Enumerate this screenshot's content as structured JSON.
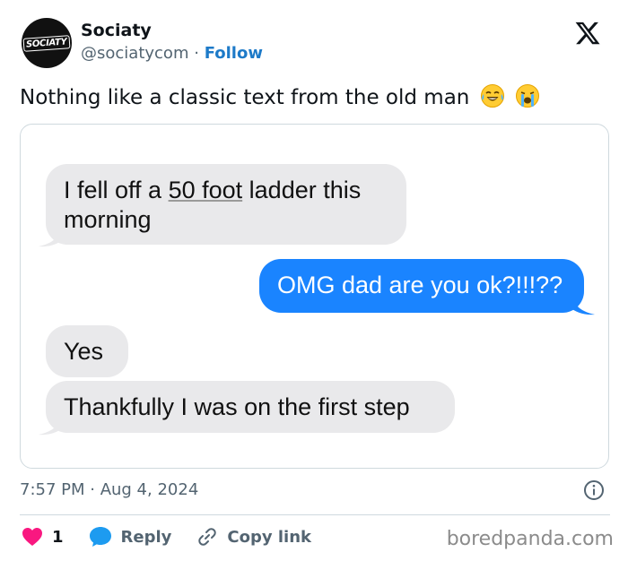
{
  "author": {
    "display_name": "Sociaty",
    "handle": "@sociatycom",
    "separator": "·",
    "follow_label": "Follow",
    "avatar_text": "SOCIATY"
  },
  "tweet": {
    "text": "Nothing like a classic text from the old man",
    "emojis": [
      "face-with-tears-of-joy-icon",
      "loudly-crying-face-icon"
    ]
  },
  "messages": [
    {
      "sender": "dad",
      "pre": "I fell off a ",
      "underlined": "50 foot",
      "post": " ladder this morning"
    },
    {
      "sender": "me",
      "text": "OMG dad are you ok?!!!??"
    },
    {
      "sender": "dad",
      "text": "Yes"
    },
    {
      "sender": "dad",
      "text": "Thankfully I was on the first step"
    }
  ],
  "meta": {
    "timestamp": "7:57 PM · Aug 4, 2024"
  },
  "actions": {
    "like_count": "1",
    "reply_label": "Reply",
    "copy_label": "Copy link"
  },
  "watermark": "boredpanda.com",
  "colors": {
    "blue_bubble": "#1a84ff",
    "gray_bubble": "#e9e9eb",
    "like_red": "#f91880",
    "reply_blue": "#1d9bf0",
    "follow_blue": "#1d7ac8"
  }
}
